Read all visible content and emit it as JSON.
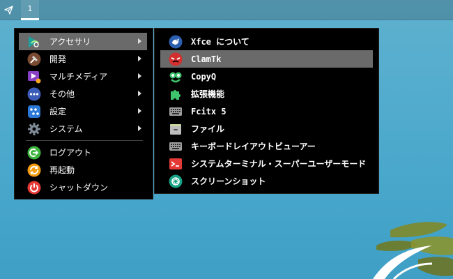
{
  "panel": {
    "workspace_label": "1"
  },
  "main_menu": {
    "categories": [
      {
        "label": "アクセサリ",
        "icon": "accessories-icon"
      },
      {
        "label": "開発",
        "icon": "development-icon"
      },
      {
        "label": "マルチメディア",
        "icon": "multimedia-icon"
      },
      {
        "label": "その他",
        "icon": "other-icon"
      },
      {
        "label": "設定",
        "icon": "settings-icon"
      },
      {
        "label": "システム",
        "icon": "system-icon"
      }
    ],
    "actions": [
      {
        "label": "ログアウト",
        "icon": "logout-icon"
      },
      {
        "label": "再起動",
        "icon": "restart-icon"
      },
      {
        "label": "シャットダウン",
        "icon": "shutdown-icon"
      }
    ]
  },
  "sub_menu": {
    "items": [
      {
        "label": "Xfce について",
        "icon": "xfce-about-icon"
      },
      {
        "label": "ClamTk",
        "icon": "clamtk-icon"
      },
      {
        "label": "CopyQ",
        "icon": "copyq-icon"
      },
      {
        "label": "拡張機能",
        "icon": "extensions-icon"
      },
      {
        "label": "Fcitx 5",
        "icon": "keyboard-icon"
      },
      {
        "label": "ファイル",
        "icon": "file-manager-icon"
      },
      {
        "label": "キーボードレイアウトビューアー",
        "icon": "keyboard-icon"
      },
      {
        "label": "システムターミナル・スーパーユーザーモード",
        "icon": "terminal-icon"
      },
      {
        "label": "スクリーンショット",
        "icon": "screenshot-icon"
      }
    ]
  },
  "colors": {
    "desktop": "#4aa8cc",
    "menu_bg": "#000000",
    "highlight": "#6a6a6a"
  }
}
